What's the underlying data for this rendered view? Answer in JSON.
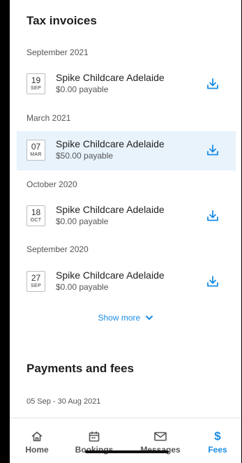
{
  "tax_invoices": {
    "title": "Tax invoices",
    "groups": [
      {
        "label": "September 2021",
        "day": "19",
        "month": "SEP",
        "provider": "Spike Childcare Adelaide",
        "amount": "$0.00 payable"
      },
      {
        "label": "March 2021",
        "day": "07",
        "month": "MAR",
        "provider": "Spike Childcare Adelaide",
        "amount": "$50.00 payable"
      },
      {
        "label": "October 2020",
        "day": "18",
        "month": "OCT",
        "provider": "Spike Childcare Adelaide",
        "amount": "$0.00 payable"
      },
      {
        "label": "September 2020",
        "day": "27",
        "month": "SEP",
        "provider": "Spike Childcare Adelaide",
        "amount": "$0.00 payable"
      }
    ],
    "show_more": "Show more"
  },
  "payments": {
    "title": "Payments and fees",
    "range": "05 Sep - 30 Aug 2021"
  },
  "tabs": [
    {
      "label": "Home",
      "icon": "home-icon"
    },
    {
      "label": "Bookings",
      "icon": "calendar-icon"
    },
    {
      "label": "Messages",
      "icon": "mail-icon"
    },
    {
      "label": "Fees",
      "icon": "dollar-icon",
      "active": true
    }
  ],
  "colors": {
    "accent": "#1a8ce3",
    "selected_row": "#e8f3fc"
  }
}
